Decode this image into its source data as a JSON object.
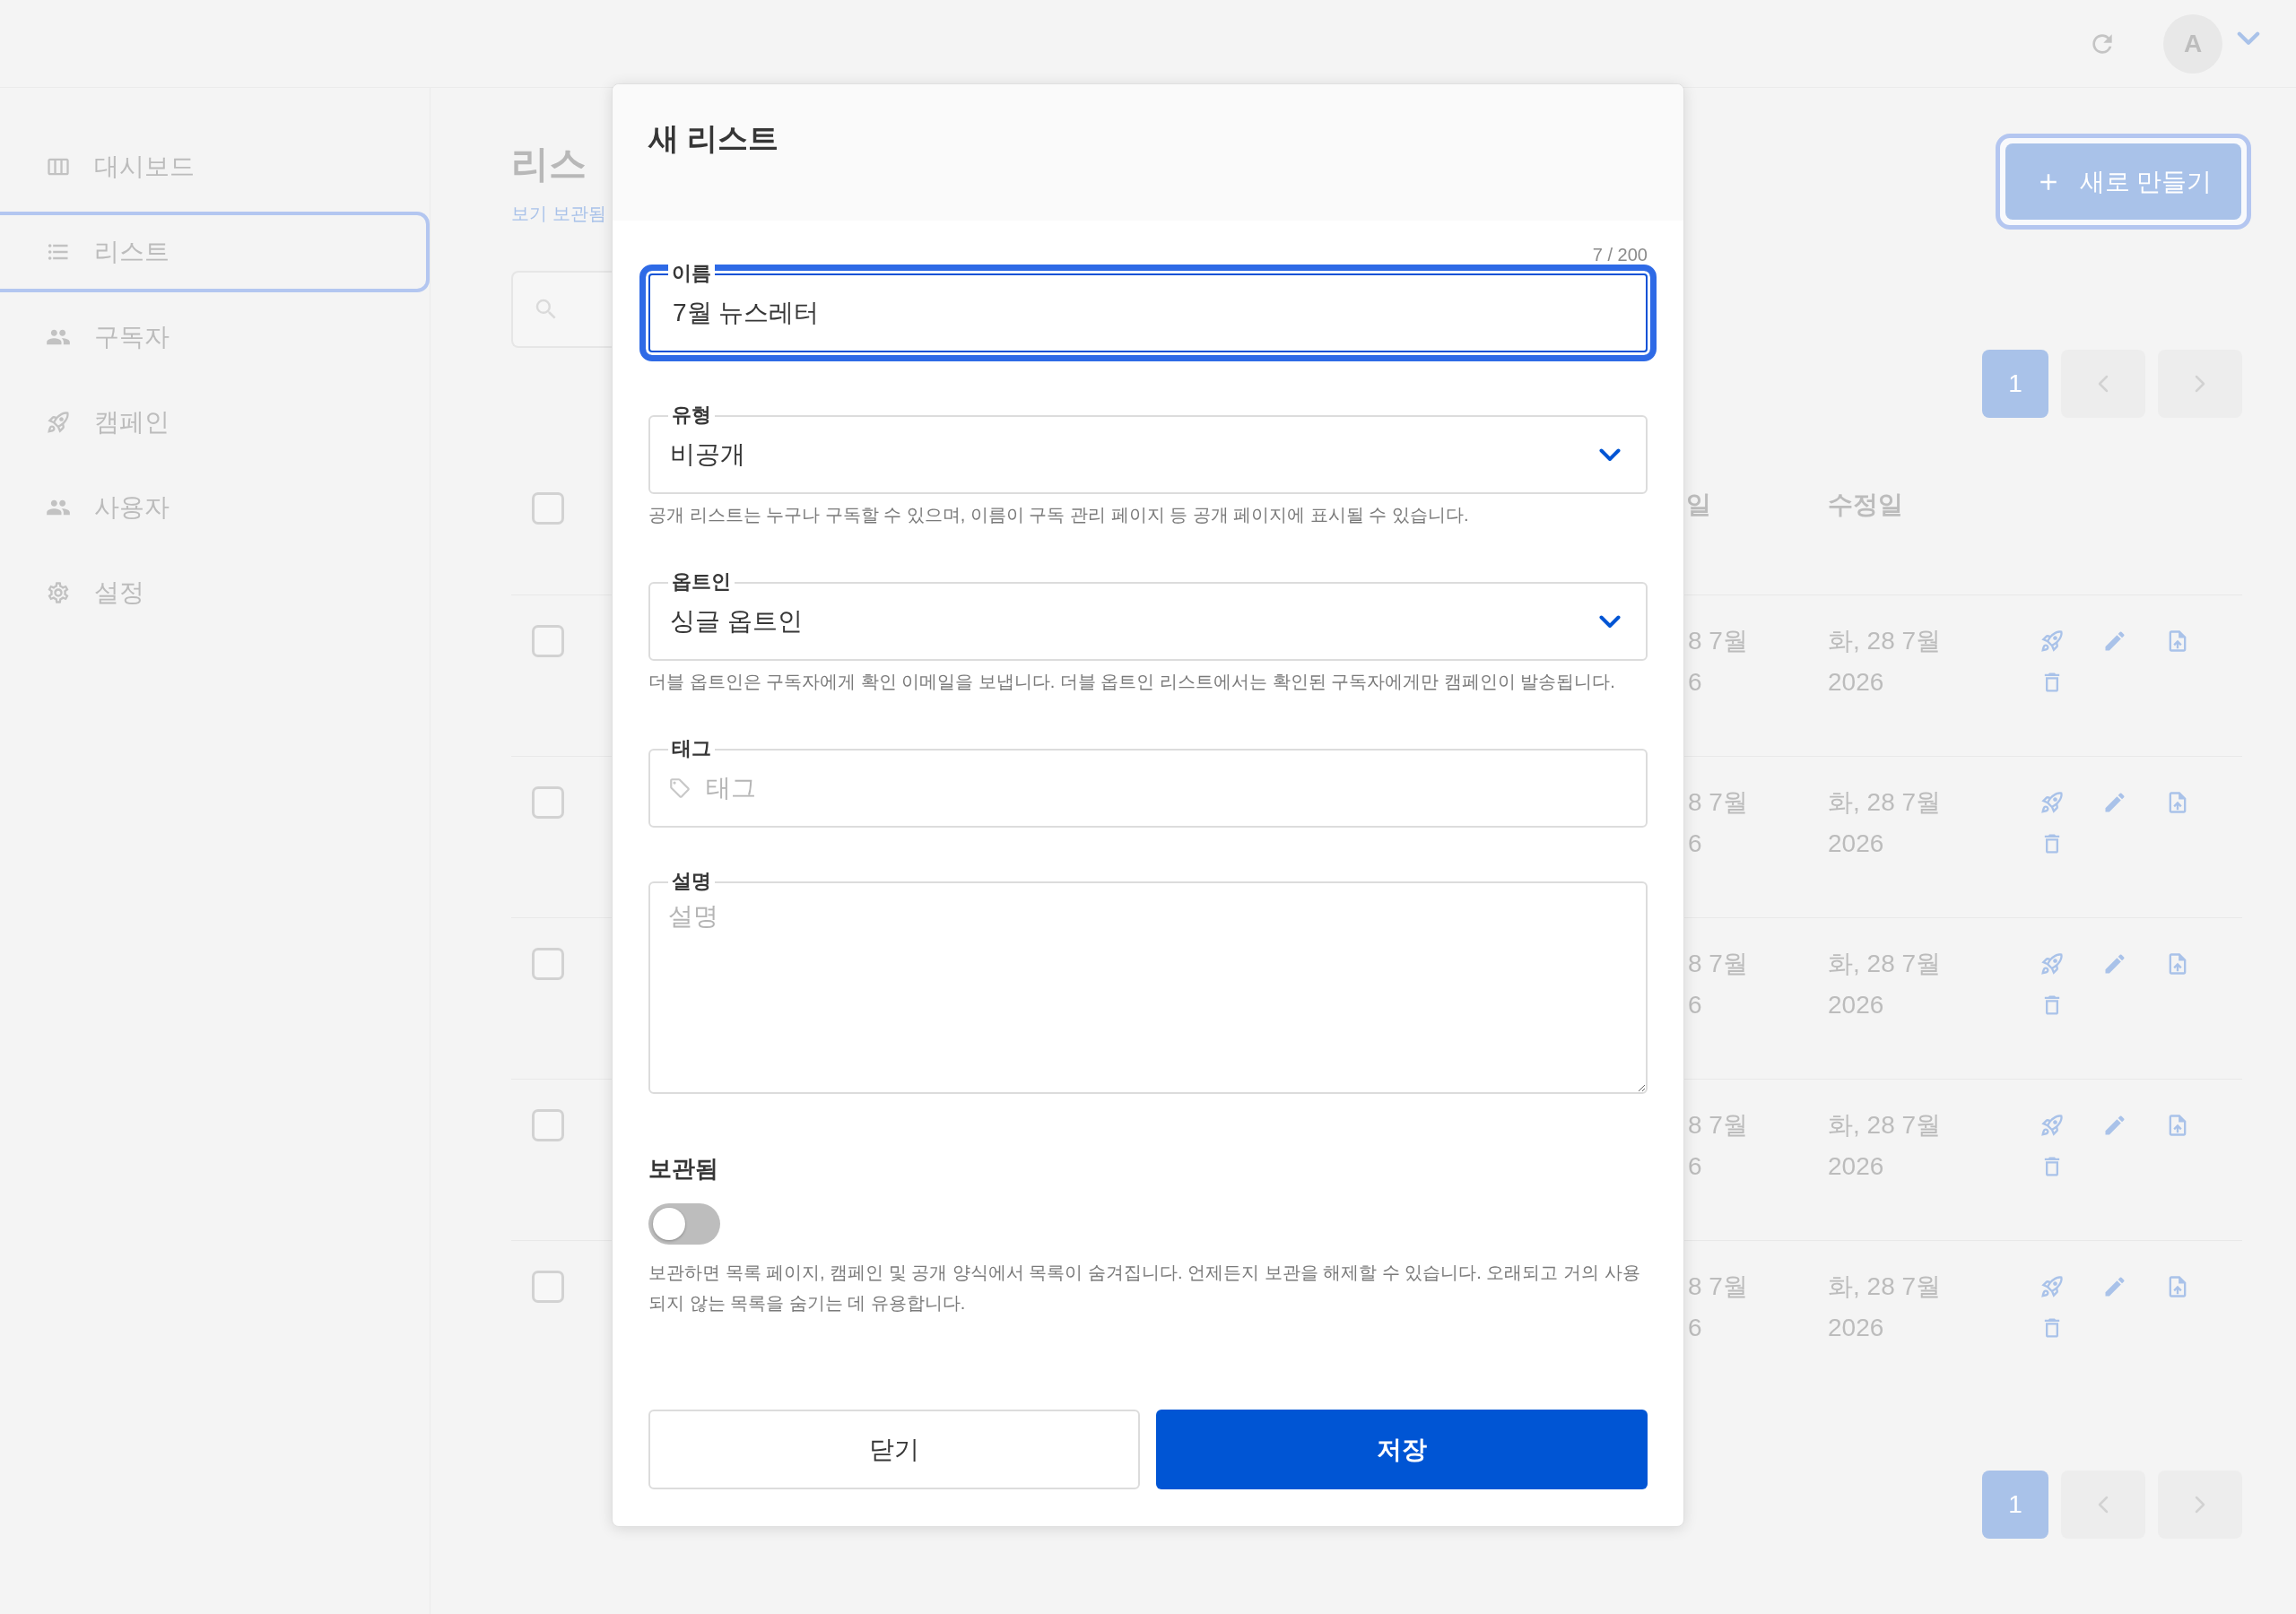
{
  "header": {
    "avatar_initial": "A"
  },
  "sidebar": {
    "items": [
      {
        "kind": "dashboard",
        "label": "대시보드",
        "selected": false
      },
      {
        "kind": "lists",
        "label": "리스트",
        "selected": true
      },
      {
        "kind": "subscribers",
        "label": "구독자",
        "selected": false
      },
      {
        "kind": "campaigns",
        "label": "캠페인",
        "selected": false
      },
      {
        "kind": "users",
        "label": "사용자",
        "selected": false
      },
      {
        "kind": "settings",
        "label": "설정",
        "selected": false
      }
    ]
  },
  "page": {
    "title": "리스",
    "archived_link": "보기 보관됨",
    "new_button": "새로 만들기",
    "pagination_top": {
      "pages": [
        {
          "label": "1",
          "selected": true
        }
      ]
    },
    "pagination_bottom": {
      "pages": [
        {
          "label": "1",
          "selected": true
        }
      ]
    }
  },
  "table": {
    "header_checkbox": {
      "checked": false
    },
    "columns": [
      {
        "label": "일"
      },
      {
        "label": "수정일"
      }
    ],
    "rows": [
      {
        "checked": false,
        "cells": [
          "8 7월 6",
          "화, 28 7월 2026"
        ]
      },
      {
        "checked": false,
        "cells": [
          "8 7월 6",
          "화, 28 7월 2026"
        ]
      },
      {
        "checked": false,
        "cells": [
          "8 7월 6",
          "화, 28 7월 2026"
        ]
      },
      {
        "checked": false,
        "cells": [
          "8 7월 6",
          "화, 28 7월 2026"
        ]
      },
      {
        "checked": false,
        "cells": [
          "8 7월 6",
          "화, 28 7월 2026"
        ]
      }
    ]
  },
  "dialog": {
    "title": "새 리스트",
    "fields": [
      {
        "kind": "text",
        "label": "이름",
        "value": "7월 뉴스레터",
        "counter": "7 / 200",
        "focused": true
      },
      {
        "kind": "select",
        "label": "유형",
        "value": "비공개",
        "focused": false,
        "help": "공개 리스트는 누구나 구독할 수 있으며, 이름이 구독 관리 페이지 등 공개 페이지에 표시될 수 있습니다."
      },
      {
        "kind": "select",
        "label": "옵트인",
        "value": "싱글 옵트인",
        "focused": false,
        "help": "더블 옵트인은 구독자에게 확인 이메일을 보냅니다. 더블 옵트인 리스트에서는 확인된 구독자에게만 캠페인이 발송됩니다."
      },
      {
        "kind": "tags",
        "label": "태그",
        "placeholder": "태그",
        "focused": false
      },
      {
        "kind": "textarea",
        "label": "설명",
        "placeholder": "설명",
        "focused": false
      },
      {
        "kind": "switch",
        "label": "보관됨",
        "on": false,
        "help": "보관하면 목록 페이지, 캠페인 및 공개 양식에서 목록이 숨겨집니다. 언제든지 보관을 해제할 수 있습니다. 오래되고 거의 사용되지 않는 목록을 숨기는 데 유용합니다."
      }
    ],
    "buttons": [
      {
        "kind": "secondary",
        "label": "닫기"
      },
      {
        "kind": "primary",
        "label": "저장"
      }
    ]
  }
}
